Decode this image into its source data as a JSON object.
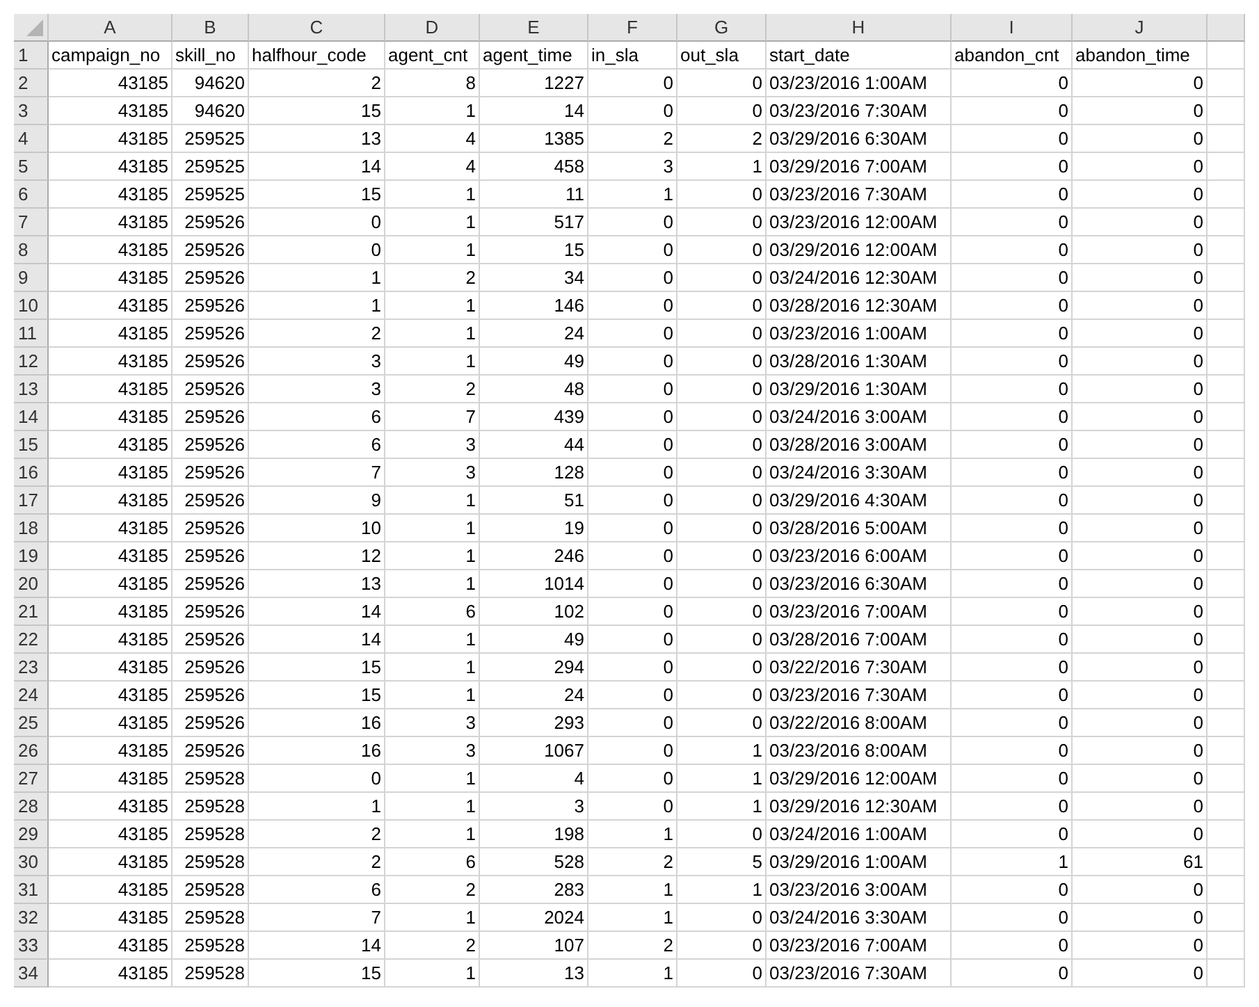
{
  "columns": [
    {
      "letter": "A",
      "kind": "number"
    },
    {
      "letter": "B",
      "kind": "number"
    },
    {
      "letter": "C",
      "kind": "number"
    },
    {
      "letter": "D",
      "kind": "number"
    },
    {
      "letter": "E",
      "kind": "number"
    },
    {
      "letter": "F",
      "kind": "number"
    },
    {
      "letter": "G",
      "kind": "number"
    },
    {
      "letter": "H",
      "kind": "text"
    },
    {
      "letter": "I",
      "kind": "number"
    },
    {
      "letter": "J",
      "kind": "number"
    }
  ],
  "rows": [
    {
      "number": "1",
      "kind": "header",
      "cells": [
        "campaign_no",
        "skill_no",
        "halfhour_code",
        "agent_cnt",
        "agent_time",
        "in_sla",
        "out_sla",
        "start_date",
        "abandon_cnt",
        "abandon_time"
      ]
    },
    {
      "number": "2",
      "kind": "data",
      "cells": [
        "43185",
        "94620",
        "2",
        "8",
        "1227",
        "0",
        "0",
        "03/23/2016 1:00AM",
        "0",
        "0"
      ]
    },
    {
      "number": "3",
      "kind": "data",
      "cells": [
        "43185",
        "94620",
        "15",
        "1",
        "14",
        "0",
        "0",
        "03/23/2016 7:30AM",
        "0",
        "0"
      ]
    },
    {
      "number": "4",
      "kind": "data",
      "cells": [
        "43185",
        "259525",
        "13",
        "4",
        "1385",
        "2",
        "2",
        "03/29/2016 6:30AM",
        "0",
        "0"
      ]
    },
    {
      "number": "5",
      "kind": "data",
      "cells": [
        "43185",
        "259525",
        "14",
        "4",
        "458",
        "3",
        "1",
        "03/29/2016 7:00AM",
        "0",
        "0"
      ]
    },
    {
      "number": "6",
      "kind": "data",
      "cells": [
        "43185",
        "259525",
        "15",
        "1",
        "11",
        "1",
        "0",
        "03/23/2016 7:30AM",
        "0",
        "0"
      ]
    },
    {
      "number": "7",
      "kind": "data",
      "cells": [
        "43185",
        "259526",
        "0",
        "1",
        "517",
        "0",
        "0",
        "03/23/2016 12:00AM",
        "0",
        "0"
      ]
    },
    {
      "number": "8",
      "kind": "data",
      "cells": [
        "43185",
        "259526",
        "0",
        "1",
        "15",
        "0",
        "0",
        "03/29/2016 12:00AM",
        "0",
        "0"
      ]
    },
    {
      "number": "9",
      "kind": "data",
      "cells": [
        "43185",
        "259526",
        "1",
        "2",
        "34",
        "0",
        "0",
        "03/24/2016 12:30AM",
        "0",
        "0"
      ]
    },
    {
      "number": "10",
      "kind": "data",
      "cells": [
        "43185",
        "259526",
        "1",
        "1",
        "146",
        "0",
        "0",
        "03/28/2016 12:30AM",
        "0",
        "0"
      ]
    },
    {
      "number": "11",
      "kind": "data",
      "cells": [
        "43185",
        "259526",
        "2",
        "1",
        "24",
        "0",
        "0",
        "03/23/2016 1:00AM",
        "0",
        "0"
      ]
    },
    {
      "number": "12",
      "kind": "data",
      "cells": [
        "43185",
        "259526",
        "3",
        "1",
        "49",
        "0",
        "0",
        "03/28/2016 1:30AM",
        "0",
        "0"
      ]
    },
    {
      "number": "13",
      "kind": "data",
      "cells": [
        "43185",
        "259526",
        "3",
        "2",
        "48",
        "0",
        "0",
        "03/29/2016 1:30AM",
        "0",
        "0"
      ]
    },
    {
      "number": "14",
      "kind": "data",
      "cells": [
        "43185",
        "259526",
        "6",
        "7",
        "439",
        "0",
        "0",
        "03/24/2016 3:00AM",
        "0",
        "0"
      ]
    },
    {
      "number": "15",
      "kind": "data",
      "cells": [
        "43185",
        "259526",
        "6",
        "3",
        "44",
        "0",
        "0",
        "03/28/2016 3:00AM",
        "0",
        "0"
      ]
    },
    {
      "number": "16",
      "kind": "data",
      "cells": [
        "43185",
        "259526",
        "7",
        "3",
        "128",
        "0",
        "0",
        "03/24/2016 3:30AM",
        "0",
        "0"
      ]
    },
    {
      "number": "17",
      "kind": "data",
      "cells": [
        "43185",
        "259526",
        "9",
        "1",
        "51",
        "0",
        "0",
        "03/29/2016 4:30AM",
        "0",
        "0"
      ]
    },
    {
      "number": "18",
      "kind": "data",
      "cells": [
        "43185",
        "259526",
        "10",
        "1",
        "19",
        "0",
        "0",
        "03/28/2016 5:00AM",
        "0",
        "0"
      ]
    },
    {
      "number": "19",
      "kind": "data",
      "cells": [
        "43185",
        "259526",
        "12",
        "1",
        "246",
        "0",
        "0",
        "03/23/2016 6:00AM",
        "0",
        "0"
      ]
    },
    {
      "number": "20",
      "kind": "data",
      "cells": [
        "43185",
        "259526",
        "13",
        "1",
        "1014",
        "0",
        "0",
        "03/23/2016 6:30AM",
        "0",
        "0"
      ]
    },
    {
      "number": "21",
      "kind": "data",
      "cells": [
        "43185",
        "259526",
        "14",
        "6",
        "102",
        "0",
        "0",
        "03/23/2016 7:00AM",
        "0",
        "0"
      ]
    },
    {
      "number": "22",
      "kind": "data",
      "cells": [
        "43185",
        "259526",
        "14",
        "1",
        "49",
        "0",
        "0",
        "03/28/2016 7:00AM",
        "0",
        "0"
      ]
    },
    {
      "number": "23",
      "kind": "data",
      "cells": [
        "43185",
        "259526",
        "15",
        "1",
        "294",
        "0",
        "0",
        "03/22/2016 7:30AM",
        "0",
        "0"
      ]
    },
    {
      "number": "24",
      "kind": "data",
      "cells": [
        "43185",
        "259526",
        "15",
        "1",
        "24",
        "0",
        "0",
        "03/23/2016 7:30AM",
        "0",
        "0"
      ]
    },
    {
      "number": "25",
      "kind": "data",
      "cells": [
        "43185",
        "259526",
        "16",
        "3",
        "293",
        "0",
        "0",
        "03/22/2016 8:00AM",
        "0",
        "0"
      ]
    },
    {
      "number": "26",
      "kind": "data",
      "cells": [
        "43185",
        "259526",
        "16",
        "3",
        "1067",
        "0",
        "1",
        "03/23/2016 8:00AM",
        "0",
        "0"
      ]
    },
    {
      "number": "27",
      "kind": "data",
      "cells": [
        "43185",
        "259528",
        "0",
        "1",
        "4",
        "0",
        "1",
        "03/29/2016 12:00AM",
        "0",
        "0"
      ]
    },
    {
      "number": "28",
      "kind": "data",
      "cells": [
        "43185",
        "259528",
        "1",
        "1",
        "3",
        "0",
        "1",
        "03/29/2016 12:30AM",
        "0",
        "0"
      ]
    },
    {
      "number": "29",
      "kind": "data",
      "cells": [
        "43185",
        "259528",
        "2",
        "1",
        "198",
        "1",
        "0",
        "03/24/2016 1:00AM",
        "0",
        "0"
      ]
    },
    {
      "number": "30",
      "kind": "data",
      "cells": [
        "43185",
        "259528",
        "2",
        "6",
        "528",
        "2",
        "5",
        "03/29/2016 1:00AM",
        "1",
        "61"
      ]
    },
    {
      "number": "31",
      "kind": "data",
      "cells": [
        "43185",
        "259528",
        "6",
        "2",
        "283",
        "1",
        "1",
        "03/23/2016 3:00AM",
        "0",
        "0"
      ]
    },
    {
      "number": "32",
      "kind": "data",
      "cells": [
        "43185",
        "259528",
        "7",
        "1",
        "2024",
        "1",
        "0",
        "03/24/2016 3:30AM",
        "0",
        "0"
      ]
    },
    {
      "number": "33",
      "kind": "data",
      "cells": [
        "43185",
        "259528",
        "14",
        "2",
        "107",
        "2",
        "0",
        "03/23/2016 7:00AM",
        "0",
        "0"
      ]
    },
    {
      "number": "34",
      "kind": "data",
      "cells": [
        "43185",
        "259528",
        "15",
        "1",
        "13",
        "1",
        "0",
        "03/23/2016 7:30AM",
        "0",
        "0"
      ]
    }
  ]
}
